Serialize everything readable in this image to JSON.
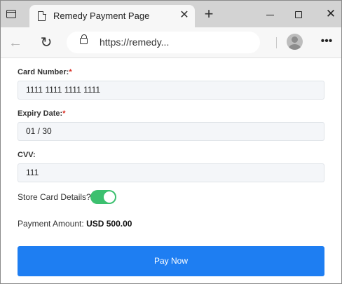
{
  "browser": {
    "tab_title": "Remedy Payment Page",
    "tab_close_glyph": "✕",
    "new_tab_glyph": "+",
    "address": "https://remedy...",
    "window_close_glyph": "✕",
    "more_glyph": "•••",
    "back_glyph": "←",
    "refresh_glyph": "↻"
  },
  "form": {
    "card_number": {
      "label": "Card Number:",
      "required_mark": "*",
      "value": "1111 1111 1111 1111"
    },
    "expiry_date": {
      "label": "Expiry Date:",
      "required_mark": "*",
      "value": "01 / 30"
    },
    "cvv": {
      "label": "CVV:",
      "value": "111"
    },
    "store_card": {
      "label": "Store Card Details?",
      "checked": true
    },
    "payment_amount": {
      "label": "Payment Amount:",
      "value": "USD 500.00"
    },
    "pay_button": "Pay Now"
  },
  "colors": {
    "accent": "#1e7ef2",
    "toggle_on": "#3cc06f",
    "required": "#d93025"
  }
}
